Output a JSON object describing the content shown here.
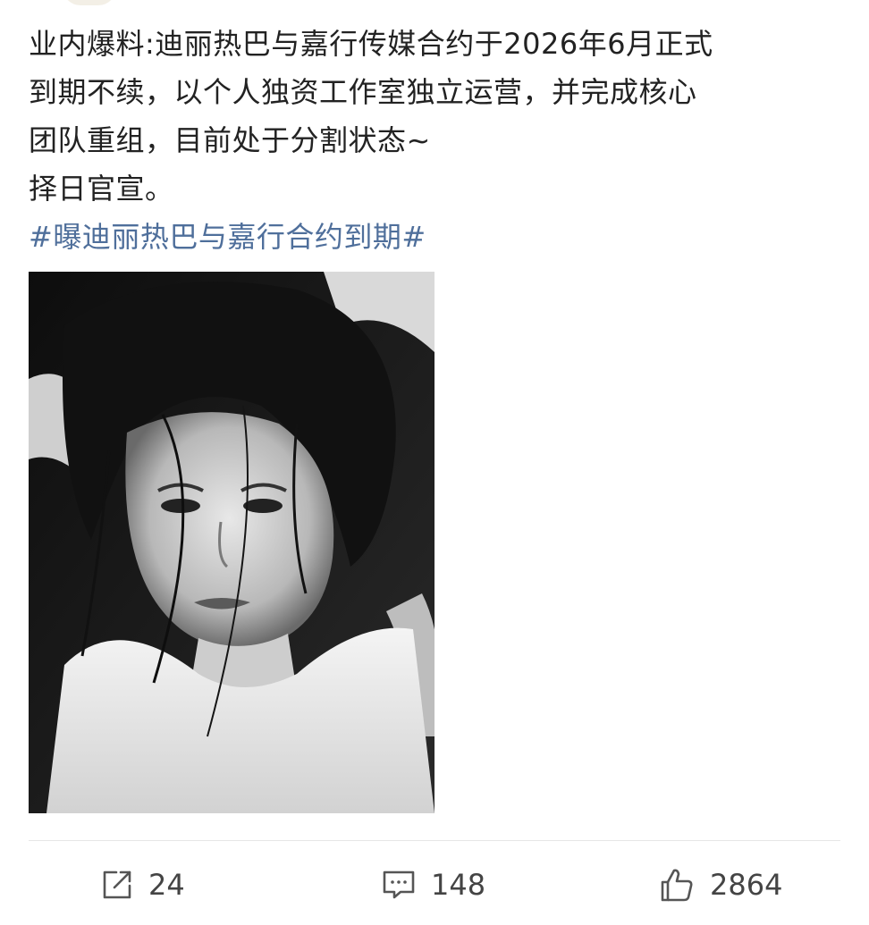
{
  "post": {
    "lines": [
      "业内爆料:迪丽热巴与嘉行传媒合约于2026年6月正式",
      "到期不续，以个人独资工作室独立运营，并完成核心",
      "团队重组，目前处于分割状态~",
      "择日官宣。"
    ],
    "hashtag": "#曝迪丽热巴与嘉行合约到期#"
  },
  "actions": {
    "repost": {
      "icon": "repost-icon",
      "count": "24"
    },
    "comment": {
      "icon": "comment-icon",
      "count": "148"
    },
    "like": {
      "icon": "thumbs-up-icon",
      "count": "2864"
    }
  },
  "colors": {
    "text": "#222222",
    "hashtag": "#4f6f9b",
    "action_text": "#444444",
    "divider": "#e6e6e6"
  }
}
